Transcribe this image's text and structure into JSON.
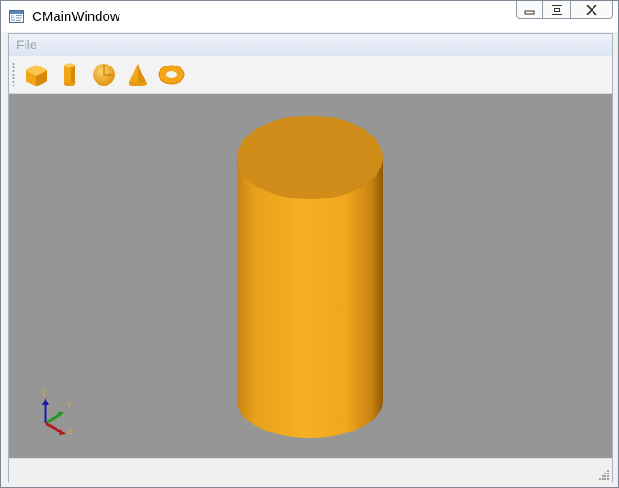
{
  "window": {
    "title": "CMainWindow"
  },
  "menubar": {
    "file_label": "File"
  },
  "toolbar": {
    "tools": [
      {
        "name": "box-icon"
      },
      {
        "name": "cylinder-icon"
      },
      {
        "name": "sphere-icon"
      },
      {
        "name": "cone-icon"
      },
      {
        "name": "torus-icon"
      }
    ]
  },
  "viewport": {
    "background": "#969696",
    "shape": "cylinder",
    "shape_color": "#f3a61c",
    "axes": {
      "z": "Z",
      "y": "Y",
      "x": "X"
    }
  },
  "colors": {
    "accent": "#f5a820"
  }
}
